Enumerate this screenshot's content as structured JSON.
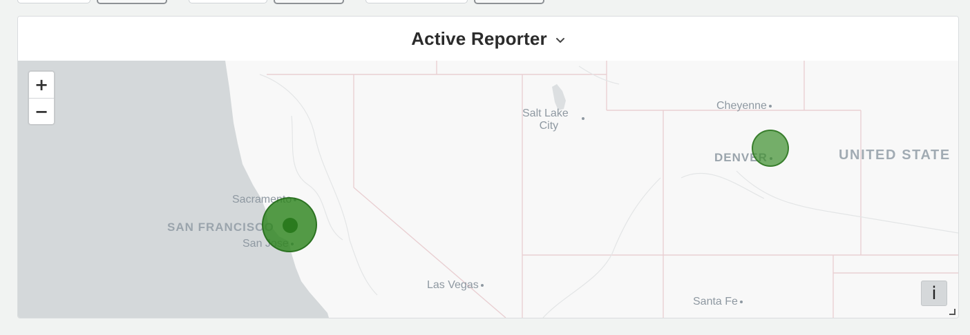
{
  "panel": {
    "title": "Active Reporter"
  },
  "map": {
    "zoom_in_label": "+",
    "zoom_out_label": "−",
    "info_label": "i",
    "place_labels": {
      "salt_lake_line1": "Salt Lake",
      "salt_lake_line2": "City",
      "cheyenne": "Cheyenne",
      "denver": "DENVER",
      "united_states": "UNITED STATE",
      "sacramento": "Sacramento",
      "san_francisco": "SAN FRANCISCO",
      "san_jose": "San Jose",
      "las_vegas": "Las Vegas",
      "santa_fe": "Santa Fe"
    },
    "colors": {
      "ocean": "#d4d8da",
      "land": "#f8f8f8",
      "border": "#e9cfd2",
      "marker": "#3c8f2c"
    }
  }
}
